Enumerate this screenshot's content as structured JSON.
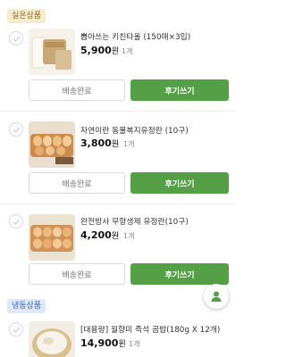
{
  "sections": {
    "room_temp_label": "실온상품",
    "frozen_label": "냉동상품"
  },
  "items": [
    {
      "title": "뽑아쓰는 키친타올 (150매×3입)",
      "price": "5,900",
      "currency": "원",
      "qty": "1개",
      "done_label": "배송완료",
      "review_label": "후기쓰기",
      "thumb": "kitchen-towel-image"
    },
    {
      "title": "자연이란 동물복지유정란 (10구)",
      "price": "3,800",
      "currency": "원",
      "qty": "1개",
      "done_label": "배송완료",
      "review_label": "후기쓰기",
      "thumb": "eggs-tray-image"
    },
    {
      "title": "완전방사 무항생제 유정란(10구)",
      "price": "4,200",
      "currency": "원",
      "qty": "1개",
      "done_label": "배송완료",
      "review_label": "후기쓰기",
      "thumb": "eggs-tray-image"
    },
    {
      "title": "[대용량] 월향미 즉석 곰밥(180g X 12개)",
      "price": "14,900",
      "currency": "원",
      "qty": "1개",
      "thumb": "rice-bowl-image"
    }
  ],
  "colors": {
    "primary_green": "#55a046",
    "room_badge_bg": "#f4eccf",
    "frozen_badge_bg": "#dfe9fb"
  },
  "icons": {
    "check": "check-icon",
    "fab": "person-icon"
  }
}
